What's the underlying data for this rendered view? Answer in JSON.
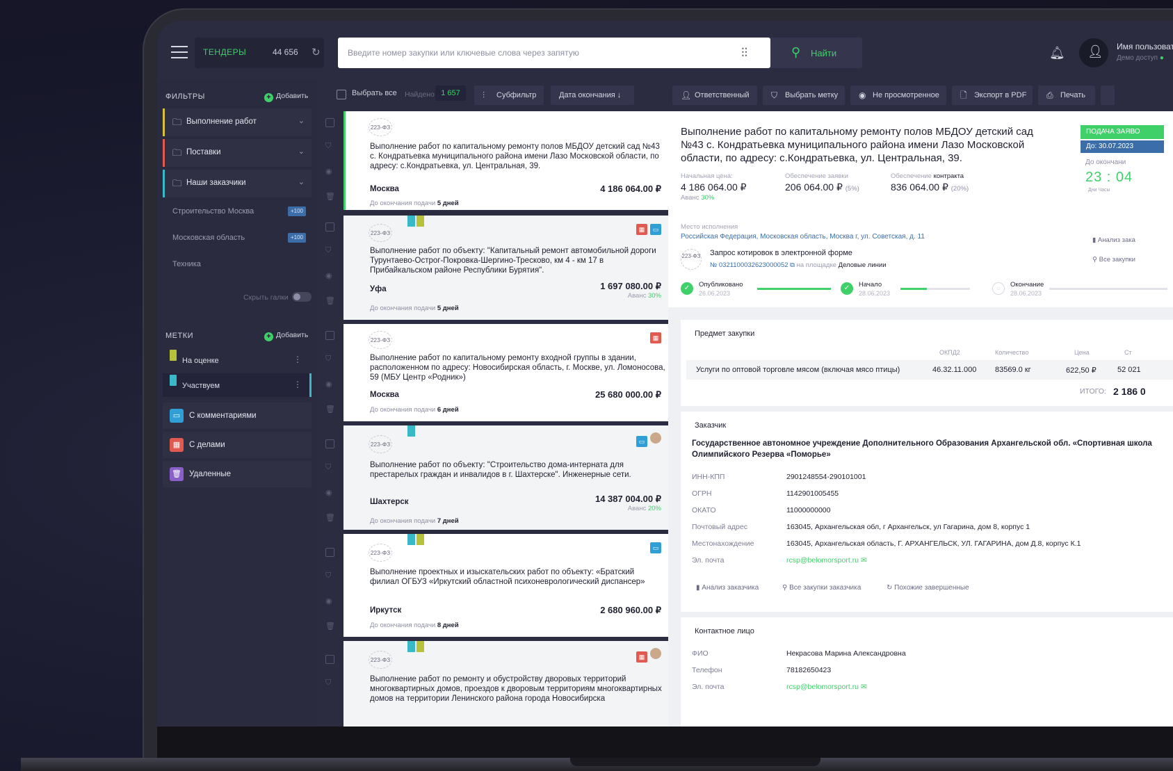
{
  "topbar": {
    "tenders_label": "ТЕНДЕРЫ",
    "tenders_count": "44 656",
    "search_placeholder": "Введите номер закупки или ключевые слова через запятую",
    "find_label": "Найти",
    "user_name": "Имя пользоват",
    "user_sub": "Демо доступ"
  },
  "sidebar": {
    "filters_title": "ФИЛЬТРЫ",
    "add_label": "Добавить",
    "folders": [
      {
        "label": "Выполнение работ",
        "color": "#d6c23a"
      },
      {
        "label": "Поставки",
        "color": "#e05a4f"
      },
      {
        "label": "Наши заказчики",
        "color": "#39b8c8"
      }
    ],
    "subitems": [
      {
        "label": "Строительство Москва",
        "badge": "+100"
      },
      {
        "label": "Московская область",
        "badge": "+100"
      },
      {
        "label": "Техника",
        "badge": ""
      }
    ],
    "hide_tags": "Скрыть галки",
    "tags_title": "МЕТКИ",
    "tags": [
      {
        "label": "На оценке",
        "color": "#b6c23a"
      },
      {
        "label": "Участвуем",
        "color": "#39b8c8"
      }
    ],
    "special": [
      {
        "label": "С комментариями",
        "color": "#2f9fd6",
        "icon": "comment-icon"
      },
      {
        "label": "С делами",
        "color": "#e05a4f",
        "icon": "calendar-icon"
      },
      {
        "label": "Удаленные",
        "color": "#8b5fc9",
        "icon": "trash-icon"
      }
    ]
  },
  "toolbar": {
    "select_all": "Выбрать все",
    "found_label": "Найдено",
    "found_count": "1 657",
    "subfilter": "Субфильтр",
    "sort": "Дата окончания ↓",
    "responsible": "Ответственный",
    "choose_tag": "Выбрать метку",
    "not_viewed": "Не просмотренное",
    "export_pdf": "Экспорт в PDF",
    "print": "Печать"
  },
  "list": [
    {
      "law": "223-ФЗ",
      "title": "Выполнение работ по капитальному ремонту полов МБДОУ детский сад №43 с. Кондратьевка муниципального района имени Лазо Московской области, по адресу: с.Кондратьевка, ул. Центральная, 39.",
      "city": "Москва",
      "price": "4 186 064.00 ₽",
      "advance": "",
      "deadline_prefix": "До окончания подачи",
      "deadline": "5 дней"
    },
    {
      "law": "223-ФЗ",
      "title": "Выполнение работ по объекту: \"Капитальный ремонт автомобильной дороги Турунтаево-Острог-Покровка-Шергино-Тресково, км 4 - км 17 в Прибайкальском районе Республики Бурятия\".",
      "city": "Уфа",
      "price": "1 697 080.00 ₽",
      "advance_prefix": "Аванс",
      "advance": "30%",
      "deadline_prefix": "До окончания подачи",
      "deadline": "5 дней"
    },
    {
      "law": "223-ФЗ",
      "title": "Выполнение работ по капитальному ремонту входной группы в здании, расположенном по адресу: Новосибирская область, г. Москве, ул. Ломоносова, 59 (МБУ Центр «Родник»)",
      "city": "Москва",
      "price": "25 680 000.00 ₽",
      "advance": "",
      "deadline_prefix": "До окончания подачи",
      "deadline": "6 дней"
    },
    {
      "law": "223-ФЗ",
      "title": "Выполнение работ по объекту: \"Строительство дома-интерната для престарелых граждан и инвалидов в г. Шахтерске\". Инженерные сети.",
      "city": "Шахтерск",
      "price": "14 387 004.00 ₽",
      "advance_prefix": "Аванс",
      "advance": "20%",
      "deadline_prefix": "До окончания подачи",
      "deadline": "7 дней"
    },
    {
      "law": "223-ФЗ",
      "title": "Выполнение проектных и изыскательских работ по объекту: «Братский филиал ОГБУЗ «Иркутский областной психоневрологический диспансер»",
      "city": "Иркутск",
      "price": "2 680 960.00 ₽",
      "advance": "",
      "deadline_prefix": "До окончания подачи",
      "deadline": "8 дней"
    },
    {
      "law": "223-ФЗ",
      "title": "Выполнение работ по ремонту и обустройству дворовых территорий многоквартирных домов, проездов к дворовым территориям многоквартирных домов на территории Ленинского района города Новосибирска",
      "city": "",
      "price": "",
      "advance": "",
      "deadline_prefix": "",
      "deadline": ""
    }
  ],
  "detail": {
    "title": "Выполнение работ по капитальному ремонту полов МБДОУ детский сад №43 с. Кондратьевка муниципального района имени Лазо Московской области, по адресу: с.Кондратьевка, ул. Центральная, 39.",
    "status": "ПОДАЧА ЗАЯВО",
    "due": "До: 30.07.2023",
    "timer_label": "До окончани",
    "timer": "23 : 04",
    "timer_units": "Дни      Часы",
    "start_price_label": "Начальная цена:",
    "start_price": "4 186 064.00 ₽",
    "advance_label": "Аванс",
    "advance": "30%",
    "bid_security_label": "Обеспечение заявки",
    "bid_security": "206 064.00 ₽",
    "bid_security_pct": "(5%)",
    "contract_security_label": "Обеспечение",
    "contract_security_label_b": "контракта",
    "contract_security": "836 064.00 ₽",
    "contract_security_pct": "(20%)",
    "place_label": "Место исполнения",
    "place": "Российская Федерация, Московская область, Москва г, ул. Советская, д. 11",
    "proc_law": "223-ФЗ",
    "proc_name": "Запрос котировок в электронной форме",
    "proc_num": "№ 0321100032623000052",
    "proc_platform_label": "на площадке",
    "proc_platform": "Деловые линии",
    "side_analysis": "Анализ зака",
    "side_all": "Все закупки",
    "timeline": [
      {
        "name": "Опубликовано",
        "date": "26.06.2023",
        "done": true
      },
      {
        "name": "Начало",
        "date": "28.06.2023",
        "done": true
      },
      {
        "name": "Окончание",
        "date": "28.06.2023",
        "done": false
      }
    ],
    "subject": {
      "title": "Предмет закупки",
      "headers": [
        "ОКПД2",
        "Количество",
        "Цена",
        "Ст"
      ],
      "row": {
        "name": "Услуги по оптовой торговле мясом (включая мясо птицы)",
        "okpd": "46.32.11.000",
        "qty": "83569.0 кг",
        "price": "622,50 ₽",
        "sum": "52 021"
      },
      "total_label": "ИТОГО:",
      "total": "2 186 0"
    },
    "customer": {
      "title": "Заказчик",
      "name": "Государственное автономное учреждение Дополнительного Образования Архангельской обл. «Спортивная школа Олимпийского Резерва «Поморье»",
      "fields": [
        {
          "k": "ИНН-КПП",
          "v": "2901248554-290101001"
        },
        {
          "k": "ОГРН",
          "v": "1142901005455"
        },
        {
          "k": "ОКАТО",
          "v": "11000000000"
        },
        {
          "k": "Почтовый адрес",
          "v": "163045, Архангельская обл, г Архангельск, ул Гагарина, дом 8, корпус 1"
        },
        {
          "k": "Местонахождение",
          "v": "163045, Архангельская область, Г. АРХАНГЕЛЬСК, УЛ. ГАГАРИНА, дом Д.8, корпус К.1"
        },
        {
          "k": "Эл. почта",
          "v": "rcsp@belomorsport.ru"
        }
      ],
      "links": [
        "Анализ заказчика",
        "Все закупки заказчика",
        "Похожие завершенные"
      ]
    },
    "contact": {
      "title": "Контактное лицо",
      "fields": [
        {
          "k": "ФИО",
          "v": "Некрасова Марина Александровна"
        },
        {
          "k": "Телефон",
          "v": "78182650423"
        },
        {
          "k": "Эл. почта",
          "v": "rcsp@belomorsport.ru"
        }
      ]
    }
  }
}
